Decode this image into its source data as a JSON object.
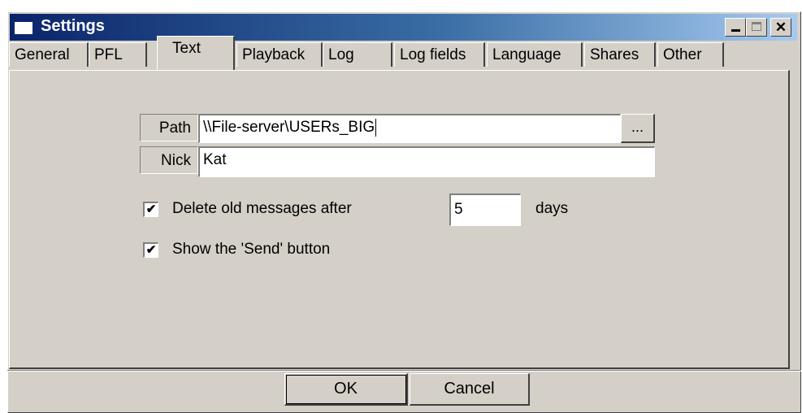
{
  "window": {
    "title": "Settings"
  },
  "tabs": [
    {
      "label": "General"
    },
    {
      "label": "PFL"
    },
    {
      "label": "Text"
    },
    {
      "label": "Playback"
    },
    {
      "label": "Log"
    },
    {
      "label": "Log fields"
    },
    {
      "label": "Language"
    },
    {
      "label": "Shares"
    },
    {
      "label": "Other"
    }
  ],
  "active_tab": "Text",
  "form": {
    "path_label": "Path",
    "path_value": "\\\\File-server\\USERs_BIG",
    "browse_label": "...",
    "nick_label": "Nick",
    "nick_value": "Kat",
    "delete_old": {
      "checked": true,
      "label": "Delete old messages after",
      "days": "5",
      "unit": "days"
    },
    "show_send": {
      "checked": true,
      "label": "Show the 'Send' button"
    }
  },
  "buttons": {
    "ok": "OK",
    "cancel": "Cancel"
  },
  "check_glyph": "✔"
}
